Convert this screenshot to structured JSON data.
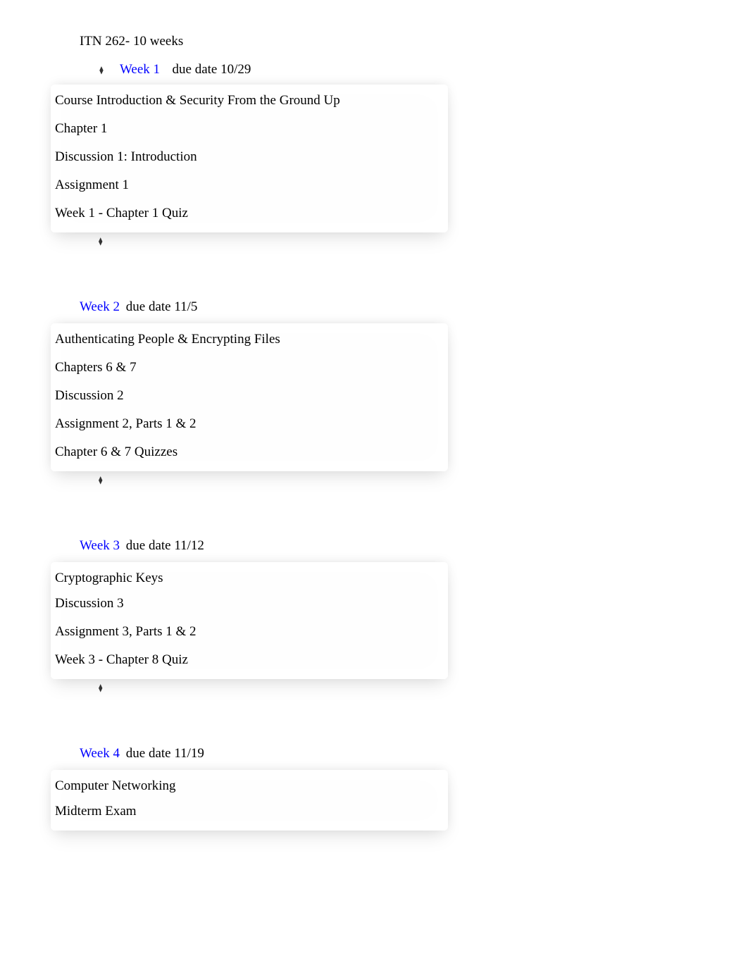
{
  "course_title": "ITN 262- 10 weeks",
  "weeks": [
    {
      "label": "Week 1",
      "due": "due date 10/29",
      "items": [
        "Course Introduction & Security From the Ground Up",
        "Chapter 1",
        "Discussion 1: Introduction",
        "Assignment 1",
        "Week 1 - Chapter 1 Quiz"
      ]
    },
    {
      "label": "Week 2",
      "due": "due date 11/5",
      "items": [
        "Authenticating People & Encrypting Files",
        "Chapters 6 & 7",
        "Discussion 2",
        "Assignment 2, Parts 1 & 2",
        "Chapter 6 & 7 Quizzes"
      ]
    },
    {
      "label": "Week 3",
      "due": "due date 11/12",
      "items": [
        "Cryptographic Keys",
        "Discussion 3",
        "Assignment 3, Parts 1 & 2",
        "Week 3 - Chapter 8 Quiz"
      ]
    },
    {
      "label": "Week 4",
      "due": "due date 11/19",
      "items": [
        "Computer Networking",
        "Midterm Exam"
      ]
    }
  ]
}
